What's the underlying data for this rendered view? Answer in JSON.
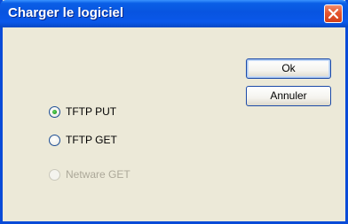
{
  "window": {
    "title": "Charger le logiciel"
  },
  "buttons": {
    "ok_label": "Ok",
    "cancel_label": "Annuler"
  },
  "options": [
    {
      "label": "TFTP PUT",
      "checked": true,
      "enabled": true
    },
    {
      "label": "TFTP GET",
      "checked": false,
      "enabled": true
    },
    {
      "label": "Netware GET",
      "checked": false,
      "enabled": false
    }
  ]
}
